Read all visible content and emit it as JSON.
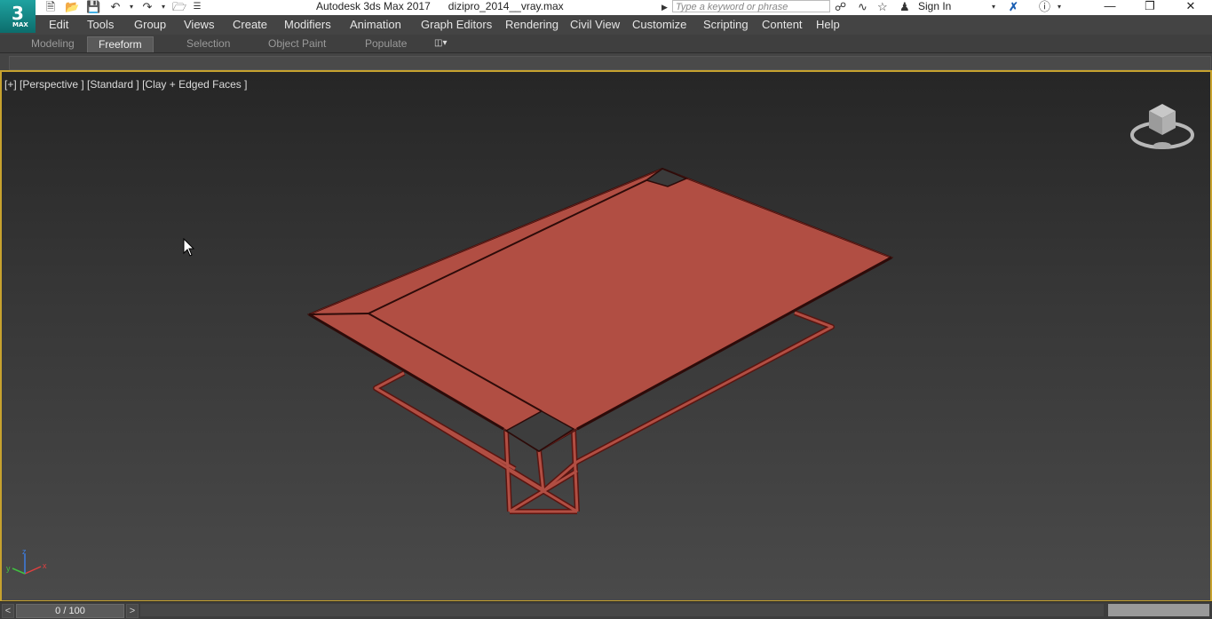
{
  "title_bar": {
    "app_logo_digit": "3",
    "app_logo_sub": "MAX",
    "app_title": "Autodesk 3ds Max 2017",
    "file_name": "dizipro_2014__vray.max",
    "search_placeholder": "Type a keyword or phrase",
    "sign_in_label": "Sign In"
  },
  "menu": {
    "items": [
      "Edit",
      "Tools",
      "Group",
      "Views",
      "Create",
      "Modifiers",
      "Animation",
      "Graph Editors",
      "Rendering",
      "Civil View",
      "Customize",
      "Scripting",
      "Content",
      "Help"
    ]
  },
  "ribbon": {
    "tabs": [
      "Modeling",
      "Freeform",
      "Selection",
      "Object Paint",
      "Populate"
    ],
    "active_tab": "Freeform"
  },
  "viewport": {
    "label": "[+] [Perspective ] [Standard ] [Clay + Edged Faces ]",
    "axis_labels": {
      "x": "x",
      "y": "y",
      "z": "z"
    }
  },
  "timeline": {
    "prev_label": "<",
    "position": "0 / 100",
    "next_label": ">"
  },
  "colors": {
    "viewport_border": "#c7a22e",
    "model_fill": "#b14e43",
    "model_edge": "#3a0d0b",
    "accent": "#1fa2a0"
  }
}
